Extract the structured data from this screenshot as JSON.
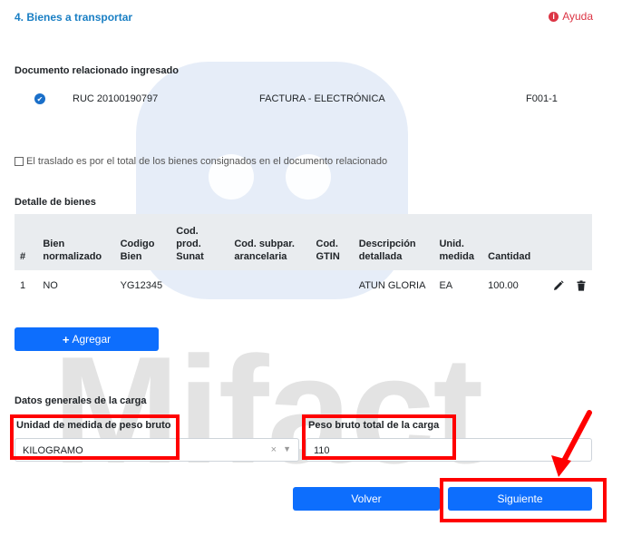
{
  "header": {
    "section_title": "4. Bienes a transportar",
    "help_label": "Ayuda"
  },
  "related_doc": {
    "heading": "Documento relacionado ingresado",
    "ruc": "RUC 20100190797",
    "doc_type": "FACTURA - ELECTRÓNICA",
    "doc_number": "F001-1"
  },
  "total_transfer_checkbox": {
    "label": "El traslado es por el total de los bienes consignados en el documento relacionado",
    "checked": false
  },
  "goods_detail": {
    "heading": "Detalle de bienes",
    "columns": [
      "#",
      "Bien normalizado",
      "Codigo Bien",
      "Cod. prod. Sunat",
      "Cod. subpar. arancelaria",
      "Cod. GTIN",
      "Descripción detallada",
      "Unid. medida",
      "Cantidad"
    ],
    "rows": [
      {
        "num": "1",
        "normalizado": "NO",
        "codigo": "YG12345",
        "sunat": "",
        "subpar": "",
        "gtin": "",
        "descripcion": "ATUN GLORIA",
        "unidad": "EA",
        "cantidad": "100.00"
      }
    ]
  },
  "add_button": {
    "label": "Agregar"
  },
  "cargo": {
    "heading": "Datos generales de la carga",
    "unit_label": "Unidad de medida de peso bruto",
    "unit_value": "KILOGRAMO",
    "clear_glyph": "×",
    "weight_label": "Peso bruto total de la carga",
    "weight_value": "110"
  },
  "footer": {
    "back_label": "Volver",
    "next_label": "Siguiente"
  },
  "watermark": {
    "text": "Mifact"
  },
  "colors": {
    "accent": "#0d6efd",
    "title": "#1a7fc4",
    "alert": "#dc3545",
    "highlight": "#ff0000"
  }
}
